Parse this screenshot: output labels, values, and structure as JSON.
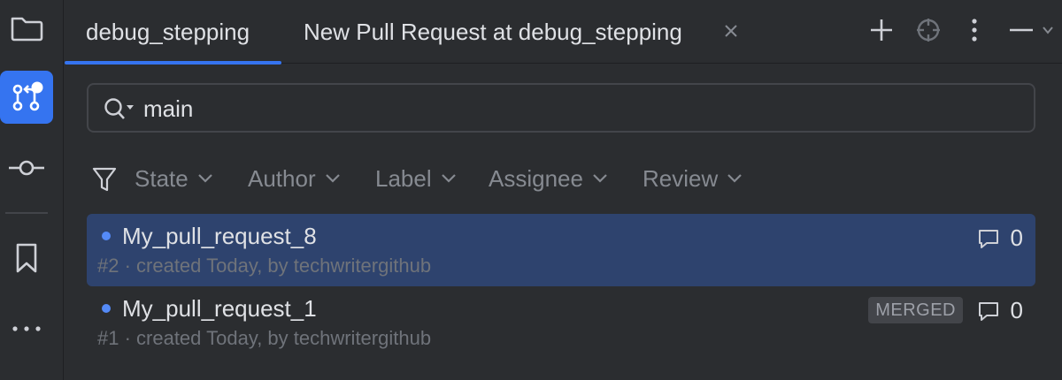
{
  "tabs": [
    {
      "label": "debug_stepping",
      "active": true
    },
    {
      "label": "New Pull Request at debug_stepping",
      "active": false
    }
  ],
  "toolbar_icons": [
    "plus-icon",
    "target-icon",
    "more-vertical-icon",
    "minimize-icon"
  ],
  "left_tools": [
    "folder-icon",
    "pull-requests-icon",
    "commit-icon",
    "bookmark-icon",
    "more-horizontal-icon"
  ],
  "search": {
    "value": "main"
  },
  "filters": [
    "State",
    "Author",
    "Label",
    "Assignee",
    "Review"
  ],
  "pull_requests": [
    {
      "title": "My_pull_request_8",
      "subtitle": "#2 · created Today, by techwritergithub",
      "comments": "0",
      "badge": "",
      "selected": true
    },
    {
      "title": "My_pull_request_1",
      "subtitle": "#1 · created Today, by techwritergithub",
      "comments": "0",
      "badge": "MERGED",
      "selected": false
    }
  ],
  "colors": {
    "accent": "#3574f0",
    "selected_row": "#2e436e",
    "background": "#2b2d30",
    "status_dot": "#548af7"
  }
}
